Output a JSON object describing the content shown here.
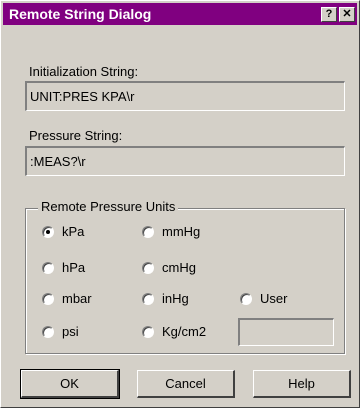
{
  "window": {
    "title": "Remote String Dialog",
    "help_label": "?",
    "close_label": "✕"
  },
  "init": {
    "label": "Initialization String:",
    "value": "UNIT:PRES KPA\\r"
  },
  "pressure": {
    "label": "Pressure String:",
    "value": ":MEAS?\\r"
  },
  "units": {
    "legend": "Remote Pressure Units",
    "selected": "kPa",
    "options": [
      "kPa",
      "hPa",
      "mbar",
      "psi",
      "mmHg",
      "cmHg",
      "inHg",
      "Kg/cm2",
      "User"
    ],
    "user_value": ""
  },
  "buttons": {
    "ok": "OK",
    "cancel": "Cancel",
    "help": "Help"
  }
}
